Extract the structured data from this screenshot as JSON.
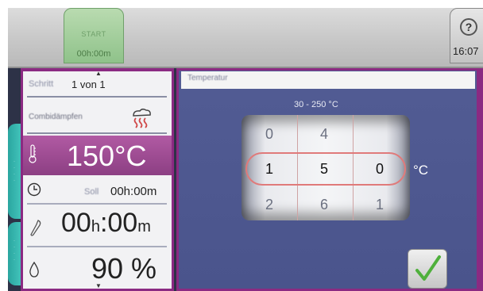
{
  "toolbar": {
    "start_label": "START",
    "start_time": "00h:00m",
    "help_glyph": "?",
    "clock": "16:07"
  },
  "left": {
    "step_label": "Schritt",
    "step_value": "1  von  1",
    "mode_label": "Combidämpfen",
    "mode_icon": "steam-icon",
    "temperature": "150°C",
    "soll_label": "Soll",
    "soll_time": "00h:00m",
    "cook_time": "00h:00m",
    "humidity": "90 %",
    "icons": [
      "thermometer-icon",
      "clock-icon",
      "probe-icon",
      "droplet-icon"
    ]
  },
  "right": {
    "param_title": "Temperatur",
    "range": "30 - 250 °C",
    "unit": "°C",
    "drum": {
      "above": [
        "0",
        "4",
        ""
      ],
      "selected": [
        "1",
        "5",
        "0"
      ],
      "below": [
        "2",
        "6",
        "1"
      ]
    },
    "confirm_icon": "checkmark-icon"
  },
  "colors": {
    "accent_purple": "#8b2a82",
    "panel_blue": "#4f5990",
    "start_green": "#8fc28a",
    "confirm_green": "#4fb03c",
    "tab_teal": "#2aa6a0"
  }
}
